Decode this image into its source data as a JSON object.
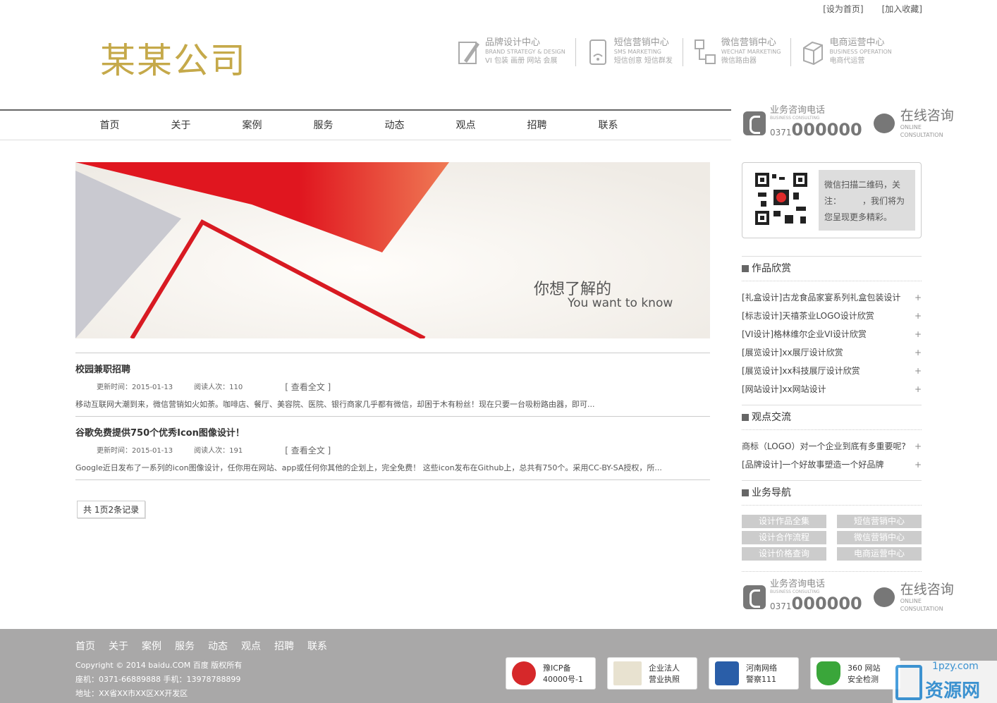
{
  "header": {
    "top_links": [
      "[设为首页]",
      "[加入收藏]"
    ],
    "logo": "某某公司",
    "services": [
      {
        "title": "品牌设计中心",
        "en": "BRAND STRATEGY & DESIGN",
        "desc": "VI 包装 画册 网站 会展",
        "icon": "pencil-icon"
      },
      {
        "title": "短信营销中心",
        "en": "SMS MARKETING",
        "desc": "短信创意 短信群发",
        "icon": "phone-icon"
      },
      {
        "title": "微信营销中心",
        "en": "WECHAT MARKETING",
        "desc": "微信路由器",
        "icon": "network-icon"
      },
      {
        "title": "电商运营中心",
        "en": "BUSINESS OPERATION",
        "desc": "电商代运营",
        "icon": "cube-icon"
      }
    ]
  },
  "nav": [
    "首页",
    "关于",
    "案例",
    "服务",
    "动态",
    "观点",
    "招聘",
    "联系"
  ],
  "consult": {
    "phone_label": "业务咨询电话",
    "phone_en": "BUSINESS CONSULTING",
    "area": "0371",
    "number": "000000",
    "online": "在线咨询",
    "online_en1": "ONLINE",
    "online_en2": "CONSULTATION"
  },
  "banner": {
    "cn": "你想了解的",
    "en": "You want to know"
  },
  "articles": [
    {
      "title": "校园兼职招聘",
      "date": "更新时间：2015-01-13",
      "views": "阅读人次：110",
      "more": "[ 查看全文 ]",
      "summary": "移动互联网大潮到来，微信营销如火如荼。咖啡店、餐厅、美容院、医院、银行商家几乎都有微信，却困于木有粉丝！现在只要一台吸粉路由器，即可..."
    },
    {
      "title": "谷歌免费提供750个优秀Icon图像设计！",
      "date": "更新时间：2015-01-13",
      "views": "阅读人次：191",
      "more": "[ 查看全文 ]",
      "summary": "Google近日发布了一系列的icon图像设计，任你用在网站、app或任何你其他的企划上，完全免费！ 这些icon发布在Github上，总共有750个。采用CC-BY-SA授权，所..."
    }
  ],
  "pager": "共 1页2条记录",
  "sidebar": {
    "qr_text": "微信扫描二维码，关注：　　　，我们将为您呈现更多精彩。",
    "works_title": "作品欣赏",
    "works": [
      "[礼盒设计]古龙食品家宴系列礼盒包装设计",
      "[标志设计]天禧茶业LOGO设计欣赏",
      "[VI设计]格林维尔企业VI设计欣赏",
      "[展览设计]xx展厅设计欣赏",
      "[展览设计]xx科技展厅设计欣赏",
      "[网站设计]xx网站设计"
    ],
    "views_title": "观点交流",
    "views": [
      "商标（LOGO）对一个企业到底有多重要呢?",
      "[品牌设计]一个好故事塑造一个好品牌"
    ],
    "biz_title": "业务导航",
    "biz": [
      "设计作品全集",
      "短信营销中心",
      "设计合作流程",
      "微信营销中心",
      "设计价格查询",
      "电商运营中心"
    ],
    "plus": "+"
  },
  "footer": {
    "nav": [
      "首页",
      "关于",
      "案例",
      "服务",
      "动态",
      "观点",
      "招聘",
      "联系"
    ],
    "copyright": "Copyright © 2014 baidu.COM 百度 版权所有",
    "phone": "座机：0371-66889888 手机：13978788899",
    "address": "地址：XX省XX市XX区XX开发区",
    "badges": [
      {
        "line1": "豫ICP备",
        "line2": "40000号-1"
      },
      {
        "line1": "企业法人",
        "line2": "营业执照"
      },
      {
        "line1": "河南网络",
        "line2": "警察111"
      },
      {
        "line1": "360 网站",
        "line2": "安全检测"
      }
    ]
  },
  "watermark": {
    "small": "1pzy.com",
    "big": "资源网"
  },
  "colors": {
    "logo": "#c5a94a",
    "footer_bg": "#a9a8a8",
    "banner_red": "#e0161f"
  }
}
